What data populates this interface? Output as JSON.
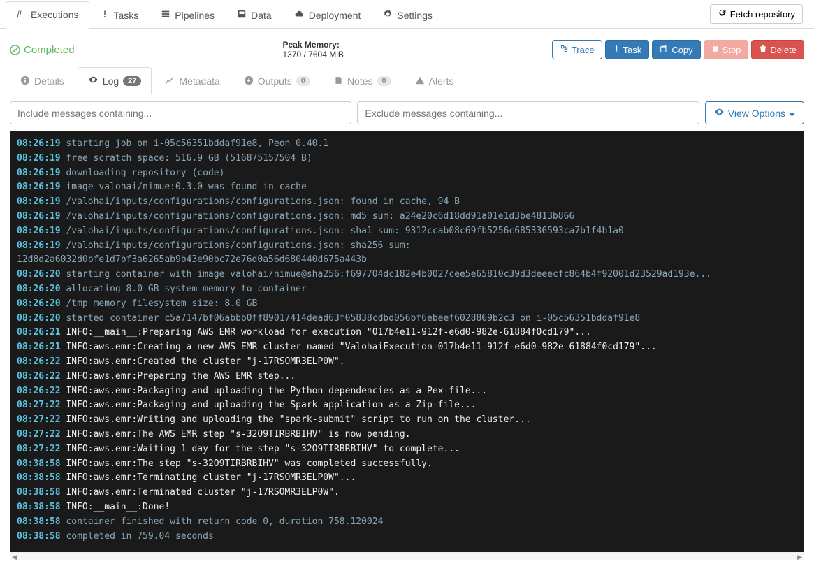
{
  "top_tabs": {
    "executions": "Executions",
    "tasks": "Tasks",
    "pipelines": "Pipelines",
    "data": "Data",
    "deployment": "Deployment",
    "settings": "Settings"
  },
  "fetch_btn": "Fetch repository",
  "status": {
    "label": "Completed"
  },
  "peak_memory": {
    "label": "Peak Memory:",
    "value": "1370 / 7604 MiB"
  },
  "actions": {
    "trace": "Trace",
    "task": "Task",
    "copy": "Copy",
    "stop": "Stop",
    "delete": "Delete"
  },
  "sub_tabs": {
    "details": "Details",
    "log": "Log",
    "log_badge": "27",
    "metadata": "Metadata",
    "outputs": "Outputs",
    "outputs_badge": "0",
    "notes": "Notes",
    "notes_badge": "0",
    "alerts": "Alerts"
  },
  "filters": {
    "include_ph": "Include messages containing...",
    "exclude_ph": "Exclude messages containing...",
    "view_options": "View Options"
  },
  "log": [
    {
      "ts": "08:26:19",
      "kind": "sys",
      "msg": "starting job on i-05c56351bddaf91e8, Peon 0.40.1"
    },
    {
      "ts": "08:26:19",
      "kind": "sys",
      "msg": "free scratch space: 516.9 GB (516875157504 B)"
    },
    {
      "ts": "08:26:19",
      "kind": "sys",
      "msg": "downloading repository (code)"
    },
    {
      "ts": "08:26:19",
      "kind": "sys",
      "msg": "image valohai/nimue:0.3.0 was found in cache"
    },
    {
      "ts": "08:26:19",
      "kind": "sys",
      "msg": "/valohai/inputs/configurations/configurations.json: found in cache, 94 B"
    },
    {
      "ts": "08:26:19",
      "kind": "sys",
      "msg": "/valohai/inputs/configurations/configurations.json: md5 sum: a24e20c6d18dd91a01e1d3be4813b866"
    },
    {
      "ts": "08:26:19",
      "kind": "sys",
      "msg": "/valohai/inputs/configurations/configurations.json: sha1 sum: 9312ccab08c69fb5256c685336593ca7b1f4b1a0"
    },
    {
      "ts": "08:26:19",
      "kind": "sys",
      "msg": "/valohai/inputs/configurations/configurations.json: sha256 sum: 12d8d2a6032d0bfe1d7bf3a6265ab9b43e90bc72e76d0a56d680440d675a443b",
      "wrap": true
    },
    {
      "ts": "08:26:20",
      "kind": "sys",
      "msg": "starting container with image valohai/nimue@sha256:f697704dc182e4b0027cee5e65810c39d3deeecfc864b4f92001d23529ad193e..."
    },
    {
      "ts": "08:26:20",
      "kind": "sys",
      "msg": "allocating 8.0 GB system memory to container"
    },
    {
      "ts": "08:26:20",
      "kind": "sys",
      "msg": "/tmp memory filesystem size: 8.0 GB"
    },
    {
      "ts": "08:26:20",
      "kind": "sys",
      "msg": "started container c5a7147bf06abbb0ff89017414dead63f05838cdbd056bf6ebeef6028869b2c3 on i-05c56351bddaf91e8"
    },
    {
      "ts": "08:26:21",
      "kind": "norm",
      "msg": "INFO:__main__:Preparing AWS EMR workload for execution \"017b4e11-912f-e6d0-982e-61884f0cd179\"..."
    },
    {
      "ts": "08:26:21",
      "kind": "norm",
      "msg": "INFO:aws.emr:Creating a new AWS EMR cluster named \"ValohaiExecution-017b4e11-912f-e6d0-982e-61884f0cd179\"..."
    },
    {
      "ts": "08:26:22",
      "kind": "norm",
      "msg": "INFO:aws.emr:Created the cluster \"j-17RSOMR3ELP0W\"."
    },
    {
      "ts": "08:26:22",
      "kind": "norm",
      "msg": "INFO:aws.emr:Preparing the AWS EMR step..."
    },
    {
      "ts": "08:26:22",
      "kind": "norm",
      "msg": "INFO:aws.emr:Packaging and uploading the Python dependencies as a Pex-file..."
    },
    {
      "ts": "08:27:22",
      "kind": "norm",
      "msg": "INFO:aws.emr:Packaging and uploading the Spark application as a Zip-file..."
    },
    {
      "ts": "08:27:22",
      "kind": "norm",
      "msg": "INFO:aws.emr:Writing and uploading the \"spark-submit\" script to run on the cluster..."
    },
    {
      "ts": "08:27:22",
      "kind": "norm",
      "msg": "INFO:aws.emr:The AWS EMR step \"s-32O9TIRBRBIHV\" is now pending."
    },
    {
      "ts": "08:27:22",
      "kind": "norm",
      "msg": "INFO:aws.emr:Waiting 1 day for the step \"s-32O9TIRBRBIHV\" to complete..."
    },
    {
      "ts": "08:38:58",
      "kind": "norm",
      "msg": "INFO:aws.emr:The step \"s-32O9TIRBRBIHV\" was completed successfully."
    },
    {
      "ts": "08:38:58",
      "kind": "norm",
      "msg": "INFO:aws.emr:Terminating cluster \"j-17RSOMR3ELP0W\"..."
    },
    {
      "ts": "08:38:58",
      "kind": "norm",
      "msg": "INFO:aws.emr:Terminated cluster \"j-17RSOMR3ELP0W\"."
    },
    {
      "ts": "08:38:58",
      "kind": "norm",
      "msg": "INFO:__main__:Done!"
    },
    {
      "ts": "08:38:58",
      "kind": "sys",
      "msg": "container finished with return code 0, duration 758.120024"
    },
    {
      "ts": "08:38:58",
      "kind": "sys",
      "msg": "completed in 759.04 seconds"
    }
  ]
}
